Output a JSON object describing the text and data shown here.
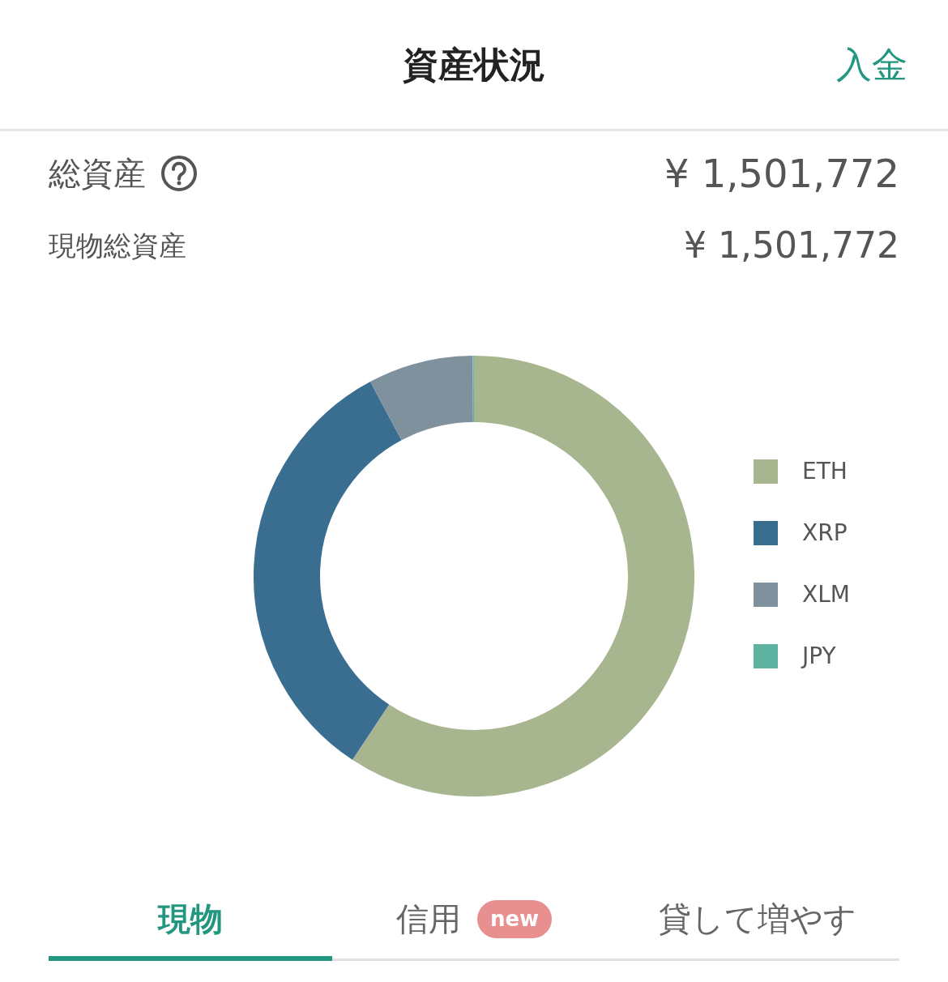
{
  "header": {
    "title": "資産状況",
    "action": "入金"
  },
  "summary": [
    {
      "label": "総資産",
      "value": "¥ 1,501,772",
      "kind": "total"
    },
    {
      "label": "現物総資産",
      "value": "¥ 1,501,772",
      "kind": "sub"
    }
  ],
  "legend": [
    {
      "label": "ETH",
      "color": "#a8b68f"
    },
    {
      "label": "XRP",
      "color": "#3a6e91"
    },
    {
      "label": "XLM",
      "color": "#80919e"
    },
    {
      "label": "JPY",
      "color": "#5bb3a0"
    }
  ],
  "tabs": [
    {
      "label": "現物",
      "selected": true
    },
    {
      "label": "信用",
      "selected": false,
      "badge": "new"
    },
    {
      "label": "貸して増やす",
      "selected": false
    }
  ]
}
